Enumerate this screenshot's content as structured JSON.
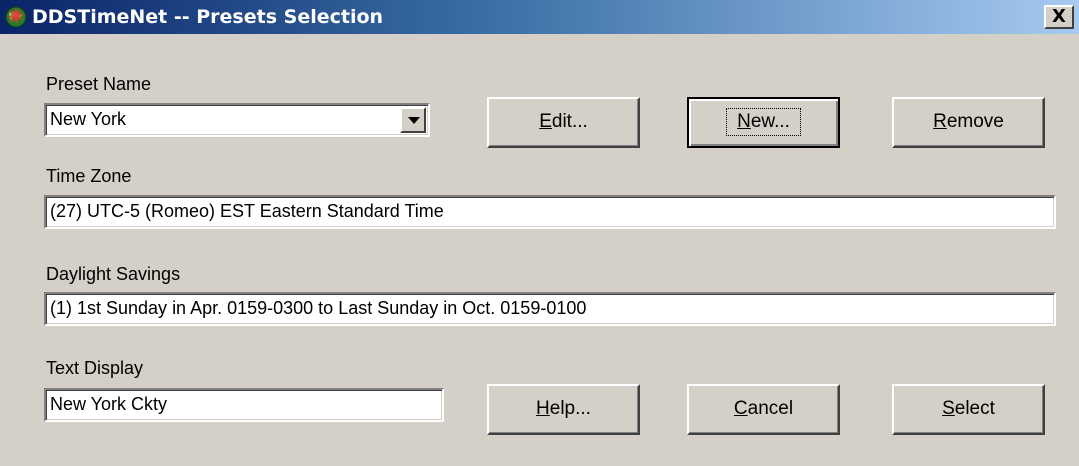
{
  "window": {
    "title": "DDSTimeNet -- Presets Selection",
    "close_glyph": "X",
    "titlebar_colors": [
      "#0a246a",
      "#a6caf0"
    ]
  },
  "preset": {
    "label": "Preset Name",
    "selected": "New York"
  },
  "buttons": {
    "edit": {
      "mnemonic": "E",
      "rest": "dit..."
    },
    "new": {
      "mnemonic": "N",
      "rest": "ew..."
    },
    "remove": {
      "mnemonic": "R",
      "rest": "emove"
    },
    "help": {
      "mnemonic": "H",
      "rest": "elp..."
    },
    "cancel": {
      "mnemonic": "C",
      "rest": "ancel"
    },
    "select": {
      "mnemonic": "S",
      "rest": "elect"
    }
  },
  "timezone": {
    "label": "Time Zone",
    "value": "(27) UTC-5 (Romeo) EST Eastern Standard Time"
  },
  "daylight": {
    "label": "Daylight Savings",
    "value": "(1) 1st Sunday in Apr. 0159-0300 to Last Sunday in Oct. 0159-0100"
  },
  "textdisplay": {
    "label": "Text Display",
    "value": "New York Ckty"
  },
  "icons": {
    "title": "globe-icon",
    "combo": "chevron-down-icon"
  }
}
